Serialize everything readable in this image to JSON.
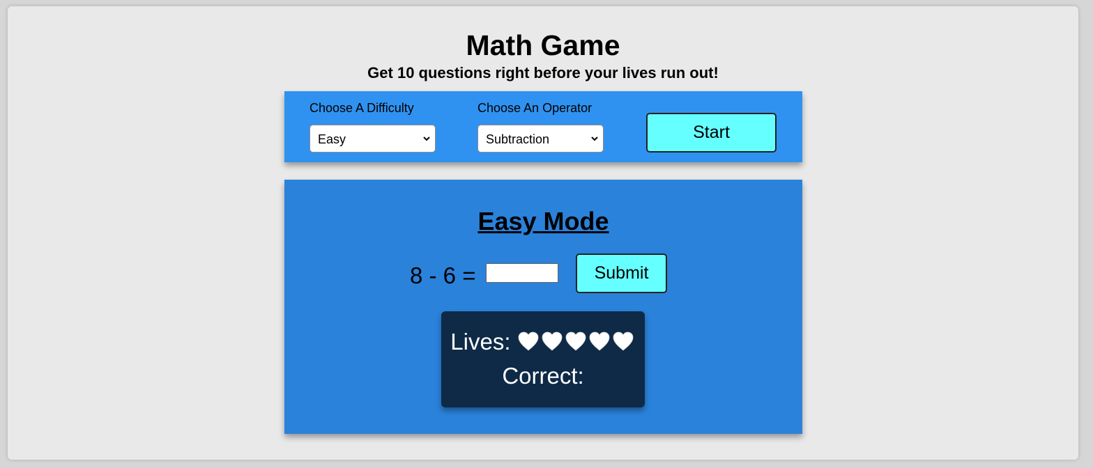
{
  "header": {
    "title": "Math Game",
    "subtitle": "Get 10 questions right before your lives run out!"
  },
  "controls": {
    "difficulty_label": "Choose A Difficulty",
    "difficulty_value": "Easy",
    "operator_label": "Choose An Operator",
    "operator_value": "Subtraction",
    "start_label": "Start"
  },
  "game": {
    "mode_title": "Easy Mode",
    "question": "8 - 6 =",
    "answer_value": "",
    "submit_label": "Submit",
    "lives_label": "Lives:",
    "lives_count": 5,
    "heart_icon": "white-heart-icon",
    "correct_label": "Correct:",
    "correct_value": ""
  },
  "colors": {
    "background": "#e9e9e9",
    "controls_bg": "#3092f0",
    "panel_bg": "#2a82da",
    "button_bg": "#66ffff",
    "status_bg": "#0e2a47"
  }
}
